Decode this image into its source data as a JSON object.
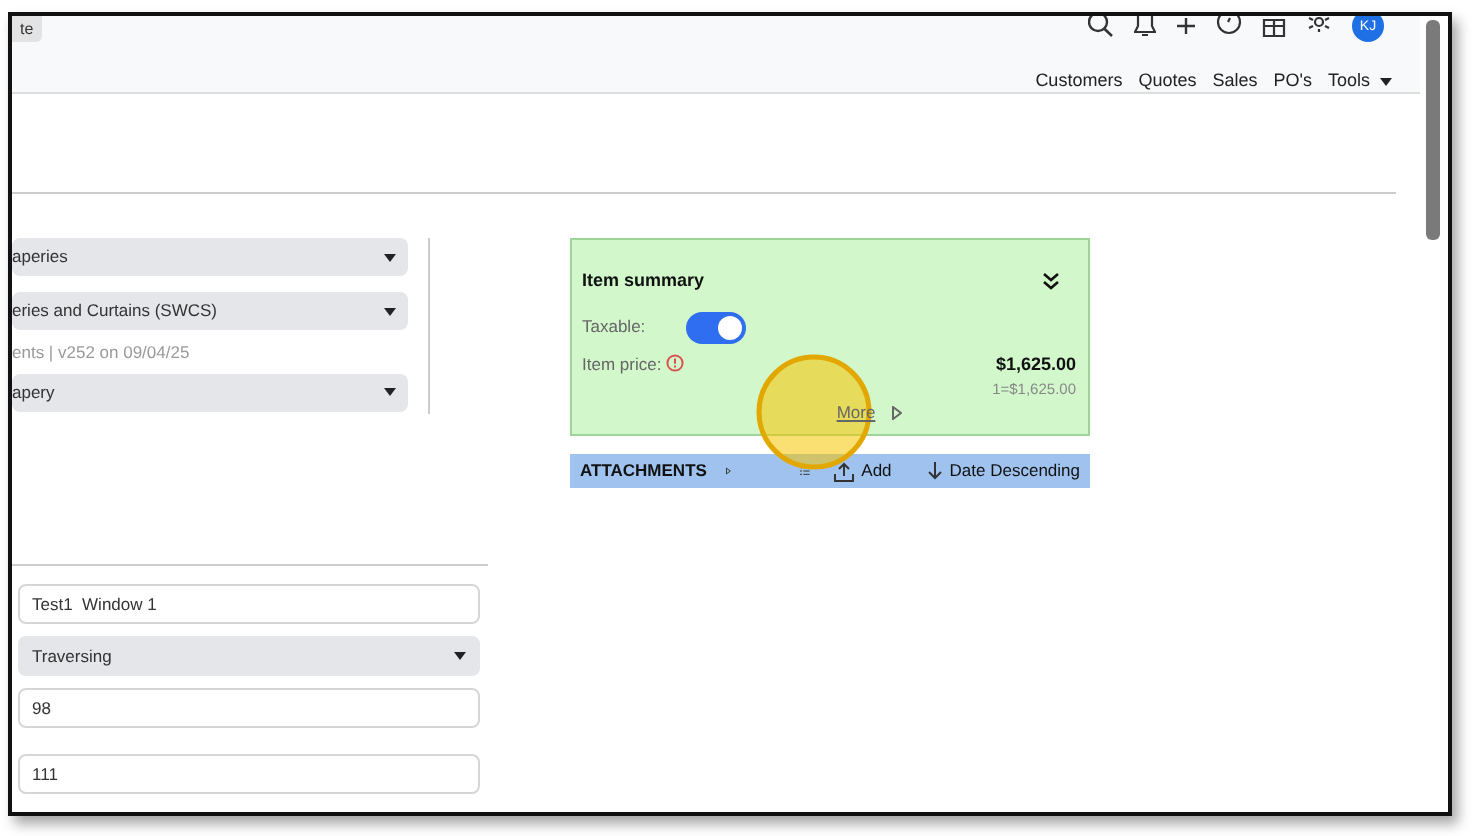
{
  "browser_tab": {
    "label": "te"
  },
  "avatar": {
    "initials": "KJ"
  },
  "nav": [
    {
      "label": "Customers",
      "has_menu": false
    },
    {
      "label": "Quotes",
      "has_menu": false
    },
    {
      "label": "Sales",
      "has_menu": false
    },
    {
      "label": "PO's",
      "has_menu": false
    },
    {
      "label": "Tools",
      "has_menu": true
    }
  ],
  "left_selects": [
    {
      "value": "aperies"
    },
    {
      "value": "eries and Curtains (SWCS)",
      "note": "ents | v252 on 09/04/25"
    },
    {
      "value": "apery"
    }
  ],
  "form_fields": [
    {
      "kind": "input",
      "value": "Test1  Window 1"
    },
    {
      "kind": "select",
      "value": "Traversing"
    },
    {
      "kind": "input",
      "value": "98"
    },
    {
      "kind": "input",
      "value": "111"
    }
  ],
  "item_summary": {
    "title": "Item summary",
    "taxable": {
      "label": "Taxable:",
      "on": true
    },
    "item_price": {
      "label": "Item price:",
      "value": "$1,625.00",
      "detail": "1=$1,625.00"
    },
    "more": "More"
  },
  "attachments": {
    "title": "ATTACHMENTS",
    "add": "Add",
    "sort": "Date Descending"
  }
}
